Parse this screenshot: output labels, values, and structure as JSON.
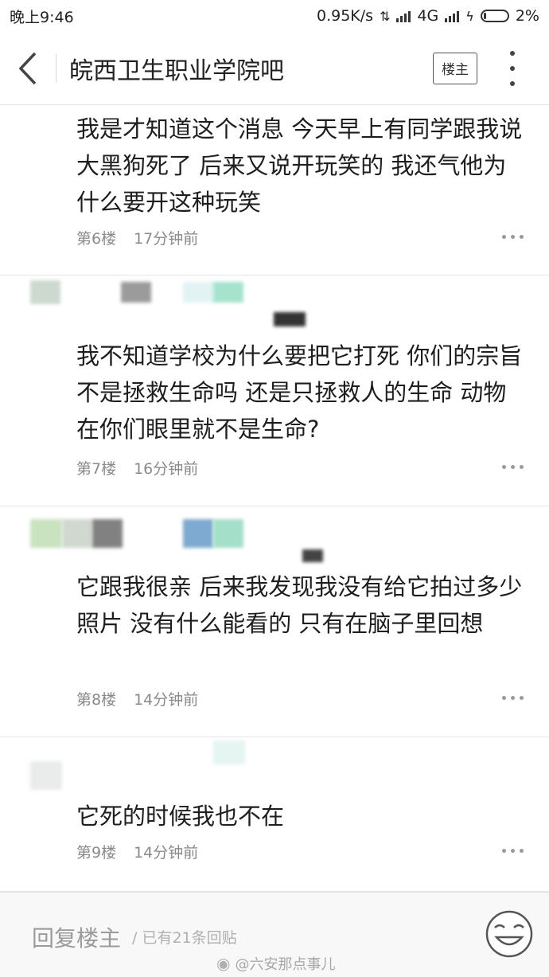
{
  "status_bar": {
    "time": "晚上9:46",
    "speed": "0.95K/s",
    "network": "4G",
    "battery": "2%"
  },
  "header": {
    "title": "皖西卫生职业学院吧",
    "lz_label": "楼主"
  },
  "posts": [
    {
      "text": "我是才知道这个消息 今天早上有同学跟我说大黑狗死了 后来又说开玩笑的 我还气他为什么要开这种玩笑",
      "floor": "第6楼",
      "time": "17分钟前"
    },
    {
      "text": "我不知道学校为什么要把它打死 你们的宗旨不是拯救生命吗 还是只拯救人的生命 动物在你们眼里就不是生命?",
      "floor": "第7楼",
      "time": "16分钟前"
    },
    {
      "text": "它跟我很亲 后来我发现我没有给它拍过多少照片 没有什么能看的 只有在脑子里回想",
      "floor": "第8楼",
      "time": "14分钟前"
    },
    {
      "text": "它死的时候我也不在",
      "floor": "第9楼",
      "time": "14分钟前"
    }
  ],
  "bottom": {
    "reply_placeholder": "回复楼主",
    "reply_count": "/ 已有21条回贴",
    "watermark": "@六安那点事儿"
  },
  "colors": {
    "text": "#1e1e1e",
    "meta": "#8a8a8a",
    "divider": "#e5e5e5"
  }
}
